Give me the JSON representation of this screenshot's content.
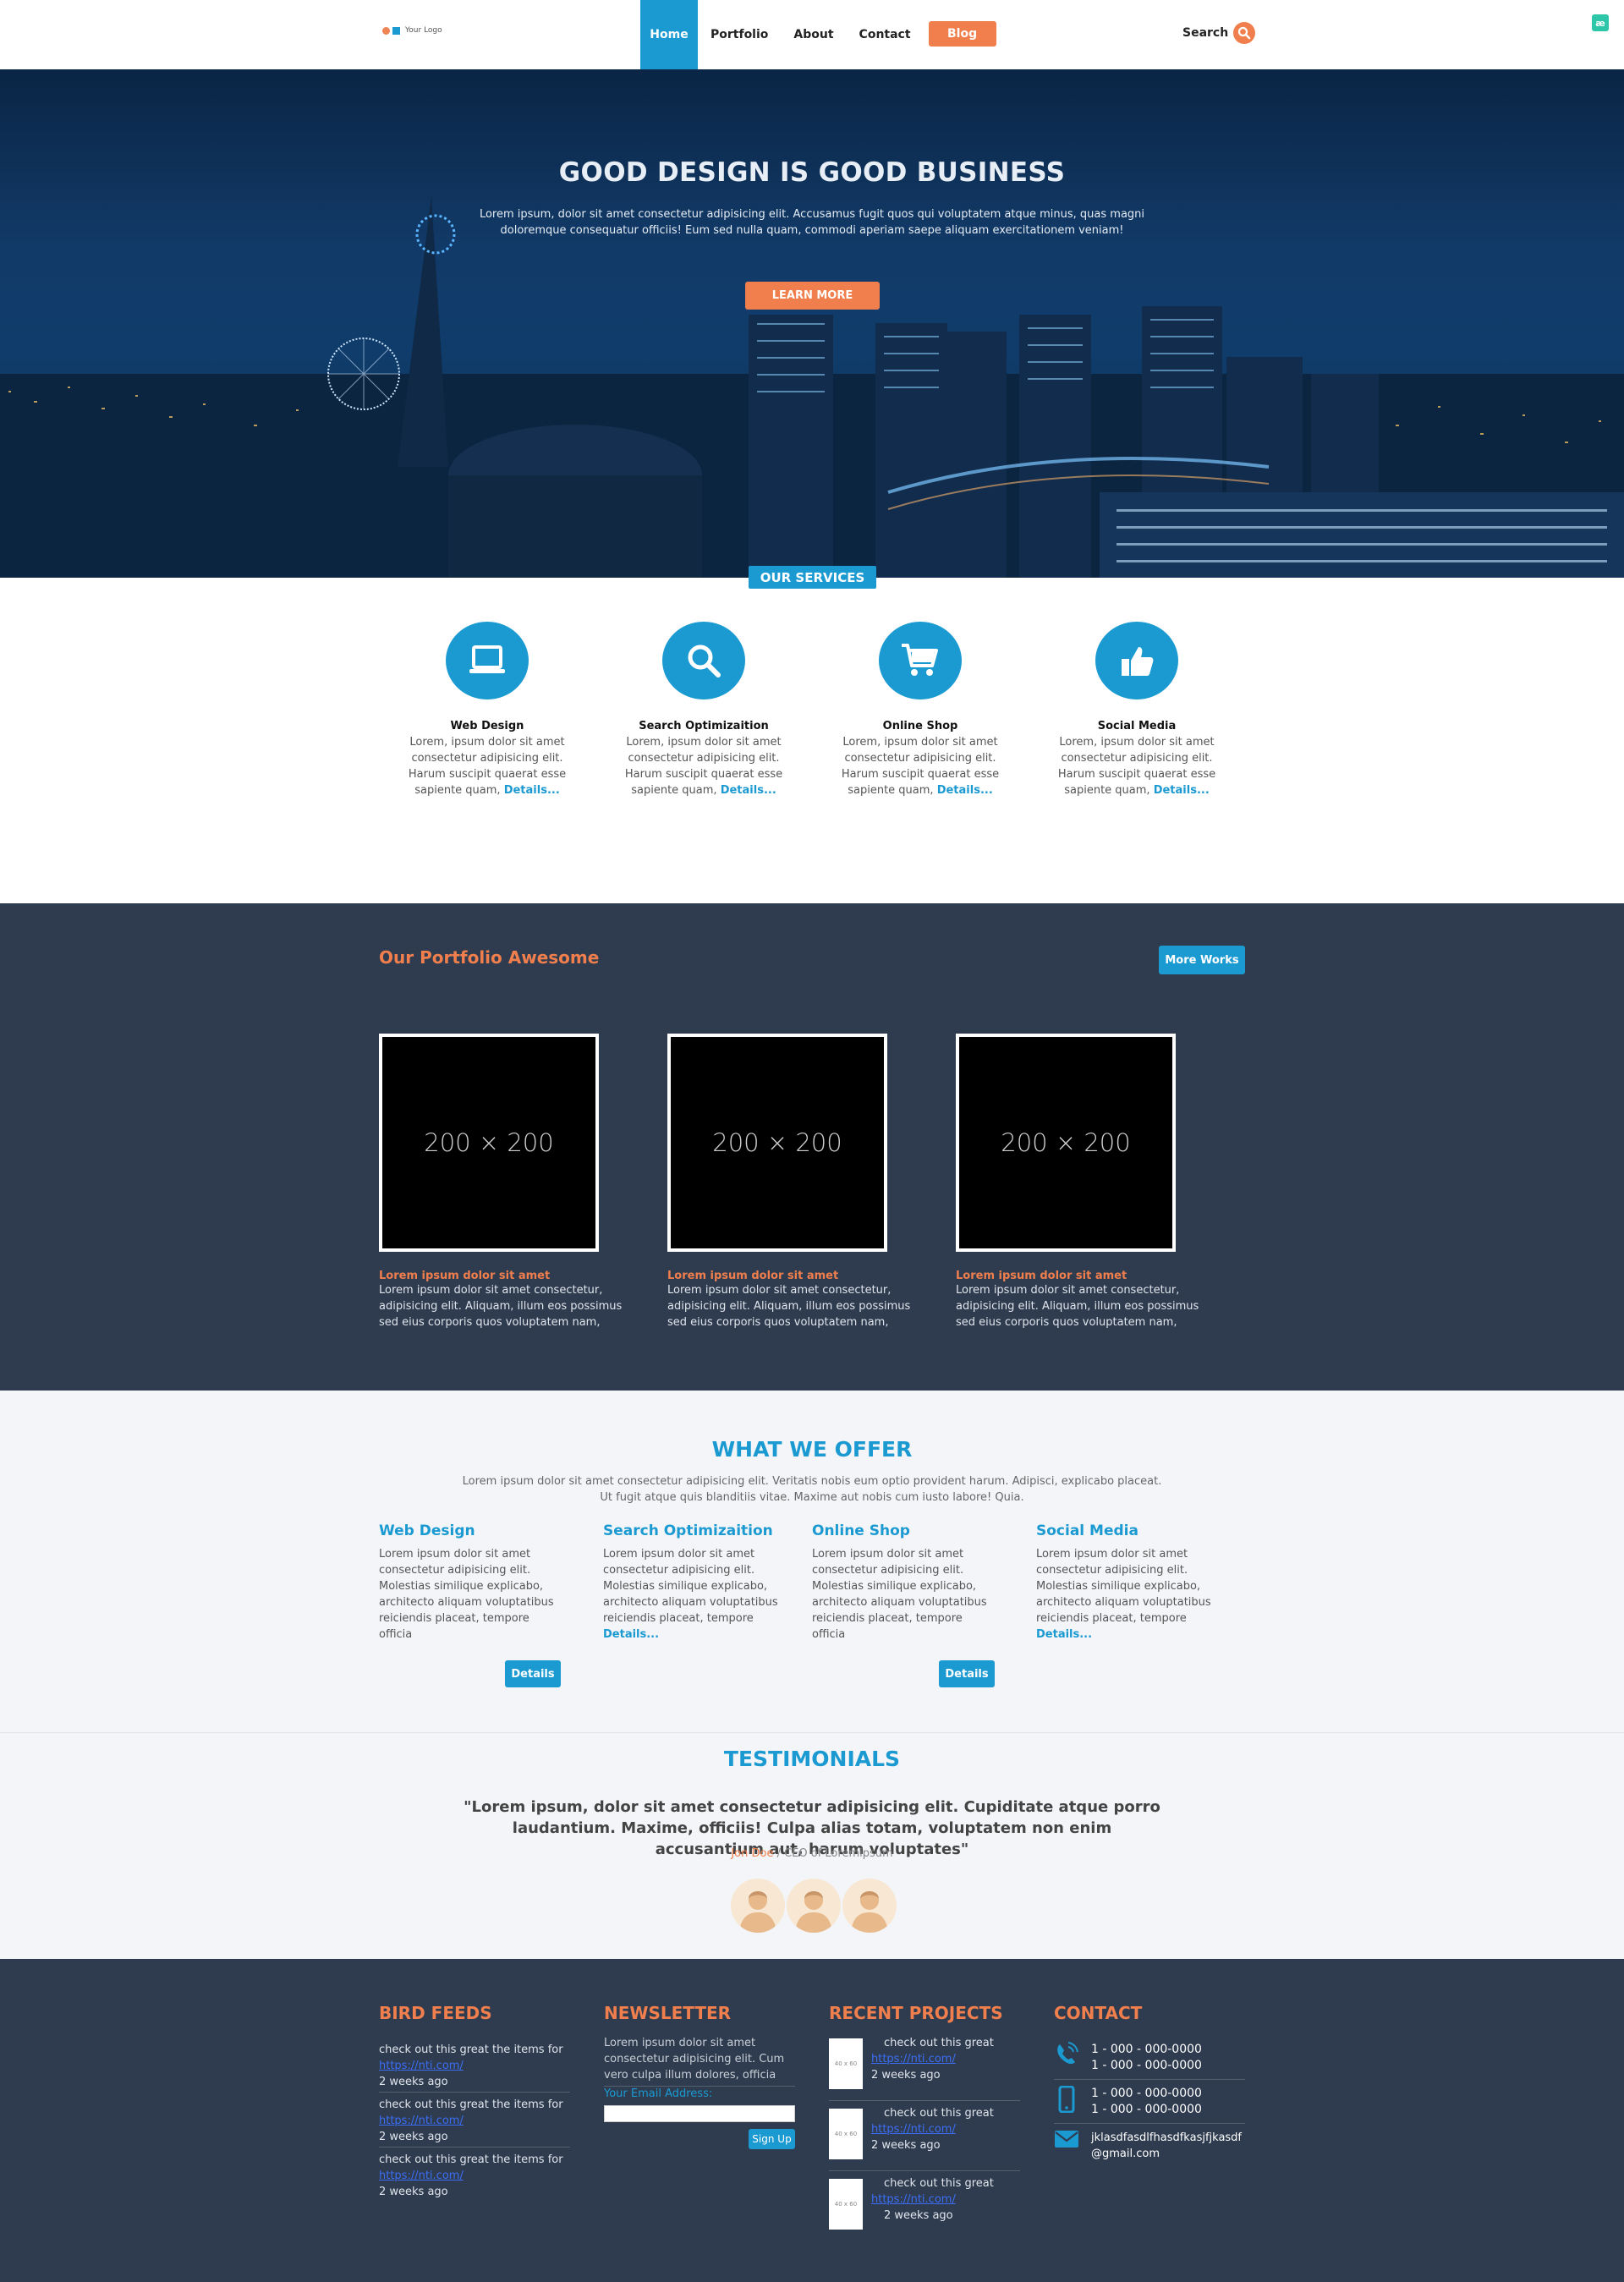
{
  "nav": {
    "logo": "Your Logo",
    "items": [
      "Home",
      "Portfolio",
      "About",
      "Contact"
    ],
    "blog": "Blog",
    "search": "Search"
  },
  "corner_badge": "æ",
  "hero": {
    "title": "GOOD DESIGN IS GOOD BUSINESS",
    "text": "Lorem ipsum, dolor sit amet consectetur adipisicing elit. Accusamus fugit quos qui voluptatem atque minus, quas magni doloremque consequatur officiis! Eum sed nulla quam, commodi aperiam saepe aliquam exercitationem veniam!",
    "button": "LEARN MORE"
  },
  "services": {
    "tag": "OUR SERVICES",
    "items": [
      {
        "title": "Web Design",
        "text": "Lorem, ipsum dolor sit amet consectetur adipisicing elit. Harum suscipit quaerat esse sapiente quam,",
        "link": "Details...",
        "icon": "laptop-icon"
      },
      {
        "title": "Search Optimizaition",
        "text": "Lorem, ipsum dolor sit amet consectetur adipisicing elit. Harum suscipit quaerat esse sapiente quam,",
        "link": "Details...",
        "icon": "search-icon"
      },
      {
        "title": "Online Shop",
        "text": "Lorem, ipsum dolor sit amet consectetur adipisicing elit. Harum suscipit quaerat esse sapiente quam,",
        "link": "Details...",
        "icon": "cart-icon"
      },
      {
        "title": "Social Media",
        "text": "Lorem, ipsum dolor sit amet consectetur adipisicing elit. Harum suscipit quaerat esse sapiente quam,",
        "link": "Details...",
        "icon": "thumbs-up-icon"
      }
    ]
  },
  "portfolio": {
    "title": "Our Portfolio Awesome",
    "more": "More Works",
    "items": [
      {
        "placeholder": "200 × 200",
        "title": "Lorem ipsum dolor sit amet",
        "text": "Lorem ipsum dolor sit amet consectetur, adipisicing elit. Aliquam, illum eos possimus sed eius corporis quos voluptatem nam,"
      },
      {
        "placeholder": "200 × 200",
        "title": "Lorem ipsum dolor sit amet",
        "text": "Lorem ipsum dolor sit amet consectetur, adipisicing elit. Aliquam, illum eos possimus sed eius corporis quos voluptatem nam,"
      },
      {
        "placeholder": "200 × 200",
        "title": "Lorem ipsum dolor sit amet",
        "text": "Lorem ipsum dolor sit amet consectetur, adipisicing elit. Aliquam, illum eos possimus sed eius corporis quos voluptatem nam,"
      }
    ]
  },
  "offer": {
    "title": "WHAT WE OFFER",
    "sub1": "Lorem ipsum dolor sit amet consectetur adipisicing elit. Veritatis nobis eum optio provident harum. Adipisci, explicabo placeat.",
    "sub2": "Ut fugit atque quis blanditiis vitae. Maxime aut nobis cum iusto labore! Quia.",
    "items": [
      {
        "title": "Web Design",
        "text": "Lorem ipsum dolor sit amet consectetur adipisicing elit. Molestias similique explicabo, architecto aliquam voluptatibus reiciendis placeat, tempore officia",
        "link": ""
      },
      {
        "title": "Search Optimizaition",
        "text": "Lorem ipsum dolor sit amet consectetur adipisicing elit. Molestias similique explicabo, architecto aliquam voluptatibus reiciendis placeat, tempore",
        "link": "Details..."
      },
      {
        "title": "Online Shop",
        "text": "Lorem ipsum dolor sit amet consectetur adipisicing elit. Molestias similique explicabo, architecto aliquam voluptatibus reiciendis placeat, tempore officia",
        "link": ""
      },
      {
        "title": "Social Media",
        "text": "Lorem ipsum dolor sit amet consectetur adipisicing elit. Molestias similique explicabo, architecto aliquam voluptatibus reiciendis placeat, tempore",
        "link": "Details..."
      }
    ],
    "button": "Details"
  },
  "testimonials": {
    "title": "TESTIMONIALS",
    "quote": "\"Lorem ipsum, dolor sit amet consectetur adipisicing elit. Cupiditate atque porro laudantium. Maxime, officiis! Culpa alias totam, voluptatem non enim accusantium aut, harum voluptates\"",
    "author": "Jon Doe",
    "role": " / CEO of Loremipsum"
  },
  "footer": {
    "feeds": {
      "title": "BIRD FEEDS",
      "items": [
        {
          "text": "check out this great the items for",
          "link": "https://nti.com/",
          "time": "2 weeks ago"
        },
        {
          "text": "check out this great the items for",
          "link": "https://nti.com/",
          "time": "2 weeks ago"
        },
        {
          "text": "check out this great the items for",
          "link": "https://nti.com/",
          "time": "2 weeks ago"
        }
      ]
    },
    "newsletter": {
      "title": "NEWSLETTER",
      "text": "Lorem ipsum dolor sit amet consectetur adipisicing elit. Cum vero culpa illum dolores, officia",
      "label": "Your Email Address:",
      "button": "Sign Up"
    },
    "projects": {
      "title": "RECENT PROJECTS",
      "thumb": "40 x 60",
      "items": [
        {
          "text": "check out this great",
          "link": "https://nti.com/",
          "time": "2 weeks ago"
        },
        {
          "text": "check out this great",
          "link": "https://nti.com/",
          "time": "2 weeks ago"
        },
        {
          "text": "check out this great",
          "link": "https://nti.com/",
          "time": "2 weeks ago"
        }
      ]
    },
    "contact": {
      "title": "CONTACT",
      "phone1": "1 - 000 - 000-0000",
      "phone2": "1 - 000 - 000-0000",
      "mobile1": "1 - 000 - 000-0000",
      "mobile2": "1 - 000 - 000-0000",
      "email1": "jklasdfasdlfhasdfkasjfjkasdf",
      "email2": "@gmail.com"
    }
  },
  "colors": {
    "accent": "#1b9ad2",
    "orange": "#f07f4d",
    "dark": "#2f3c4f"
  }
}
